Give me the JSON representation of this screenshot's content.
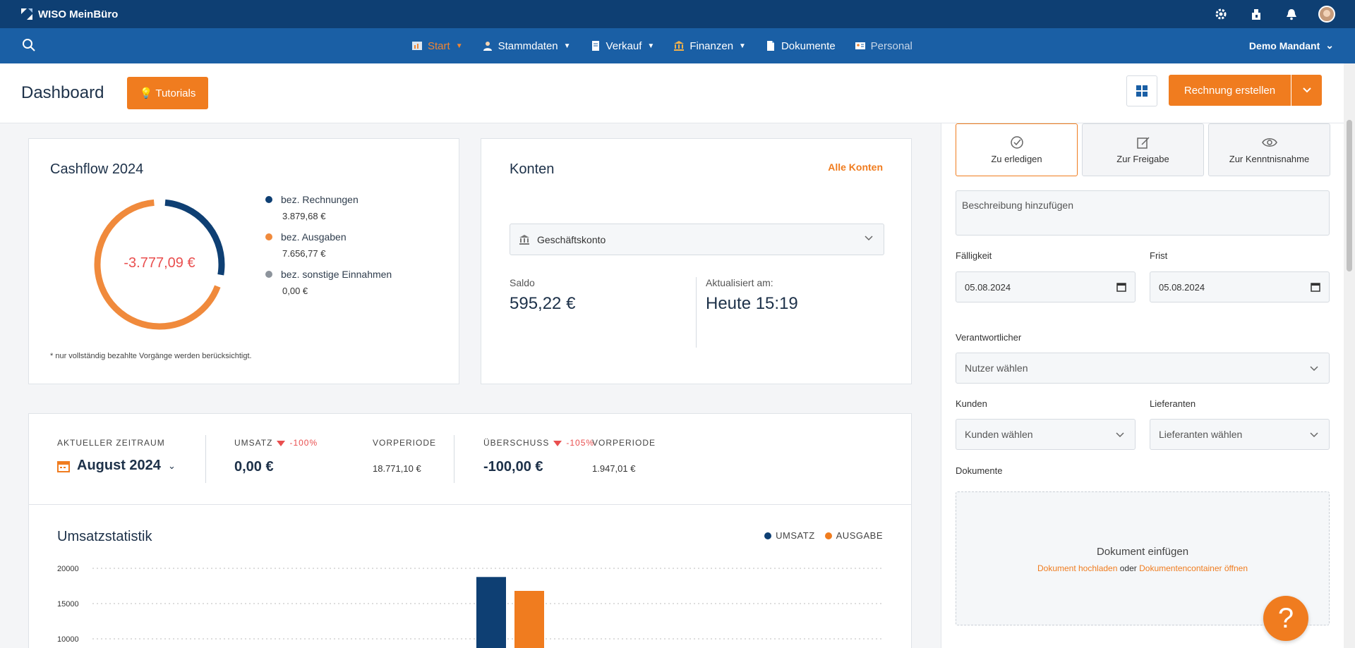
{
  "topbar": {
    "brand": "WISO MeinBüro"
  },
  "nav": {
    "items": [
      {
        "label": "Start",
        "icon": "chart-icon",
        "active": true,
        "dropdown": true
      },
      {
        "label": "Stammdaten",
        "icon": "person-icon",
        "dropdown": true
      },
      {
        "label": "Verkauf",
        "icon": "document-icon",
        "dropdown": true
      },
      {
        "label": "Finanzen",
        "icon": "bank-icon",
        "dropdown": true
      },
      {
        "label": "Dokumente",
        "icon": "file-icon",
        "dropdown": false
      },
      {
        "label": "Personal",
        "icon": "id-card-icon",
        "dropdown": false,
        "disabled": true
      }
    ],
    "mandant": "Demo Mandant"
  },
  "header": {
    "title": "Dashboard",
    "tutorials_label": "Tutorials",
    "create_invoice_label": "Rechnung erstellen"
  },
  "cashflow": {
    "title": "Cashflow 2024",
    "total": "-3.777,09 €",
    "legend": [
      {
        "label": "bez. Rechnungen",
        "value": "3.879,68 €",
        "color": "#0e3f73"
      },
      {
        "label": "bez. Ausgaben",
        "value": "7.656,77 €",
        "color": "#f08a3c"
      },
      {
        "label": "bez. sonstige Einnahmen",
        "value": "0,00 €",
        "color": "#8d949c"
      }
    ],
    "note": "* nur vollständig bezahlte Vorgänge werden berücksichtigt."
  },
  "konten": {
    "title": "Konten",
    "all_link": "Alle Konten",
    "selected_account": "Geschäftskonto",
    "saldo_label": "Saldo",
    "saldo_value": "595,22 €",
    "updated_label": "Aktualisiert am:",
    "updated_value": "Heute 15:19"
  },
  "period": {
    "label": "AKTUELLER ZEITRAUM",
    "value": "August 2024",
    "umsatz_label": "UMSATZ",
    "umsatz_change": "-100%",
    "umsatz_value": "0,00 €",
    "vorperiode_label": "VORPERIODE",
    "umsatz_prev": "18.771,10 €",
    "ueberschuss_label": "ÜBERSCHUSS",
    "ueberschuss_change": "-105%",
    "ueberschuss_value": "-100,00 €",
    "ueberschuss_prev": "1.947,01 €"
  },
  "umsatz": {
    "title": "Umsatzstatistik",
    "legend_umsatz": "UMSATZ",
    "legend_ausgabe": "AUSGABE"
  },
  "chart_data": {
    "type": "bar",
    "title": "Umsatzstatistik",
    "yticks": [
      10000,
      15000,
      20000
    ],
    "ylim": [
      10000,
      20000
    ],
    "series": [
      {
        "name": "UMSATZ",
        "color": "#0e3f73",
        "values": [
          18771.1
        ]
      },
      {
        "name": "AUSGABE",
        "color": "#f07c1f",
        "values": [
          16800
        ]
      }
    ],
    "legend_position": "top-right",
    "grid": true
  },
  "rightpanel": {
    "tabs": [
      {
        "label": "Zu erledigen",
        "icon": "check-circle-icon",
        "active": true
      },
      {
        "label": "Zur Freigabe",
        "icon": "edit-icon"
      },
      {
        "label": "Zur Kenntnisnahme",
        "icon": "eye-icon"
      }
    ],
    "description_placeholder": "Beschreibung hinzufügen",
    "faelligkeit_label": "Fälligkeit",
    "faelligkeit_value": "05.08.2024",
    "frist_label": "Frist",
    "frist_value": "05.08.2024",
    "verantwortlicher_label": "Verantwortlicher",
    "verantwortlicher_placeholder": "Nutzer wählen",
    "kunden_label": "Kunden",
    "kunden_placeholder": "Kunden wählen",
    "lieferanten_label": "Lieferanten",
    "lieferanten_placeholder": "Lieferanten wählen",
    "dokumente_label": "Dokumente",
    "dropzone_title": "Dokument einfügen",
    "dropzone_upload": "Dokument hochladen",
    "dropzone_or": "oder",
    "dropzone_container": "Dokumentencontainer öffnen"
  },
  "colors": {
    "accent": "#f07c1f",
    "navy": "#0e3f73",
    "nav": "#1a5fa5",
    "negative": "#e94f4f"
  }
}
